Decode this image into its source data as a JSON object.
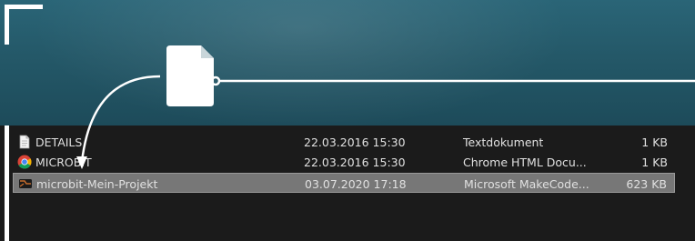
{
  "files": [
    {
      "name": "DETAILS",
      "date": "22.03.2016 15:30",
      "type": "Textdokument",
      "size": "1 KB",
      "icon": "text-document-icon",
      "selected": false
    },
    {
      "name": "MICROBIT",
      "date": "22.03.2016 15:30",
      "type": "Chrome HTML Docu...",
      "size": "1 KB",
      "icon": "chrome-icon",
      "selected": false
    },
    {
      "name": "microbit-Mein-Projekt",
      "date": "03.07.2020 17:18",
      "type": "Microsoft MakeCode...",
      "size": "623 KB",
      "icon": "makecode-icon",
      "selected": true
    }
  ],
  "colors": {
    "banner": "#245868",
    "list_background": "#1b1b1b",
    "selected_row": "#777777",
    "text": "#e0e0e0",
    "overlay": "#ffffff"
  },
  "icons": {
    "banner": "file-icon",
    "arrow": "curved-arrow-icon"
  }
}
